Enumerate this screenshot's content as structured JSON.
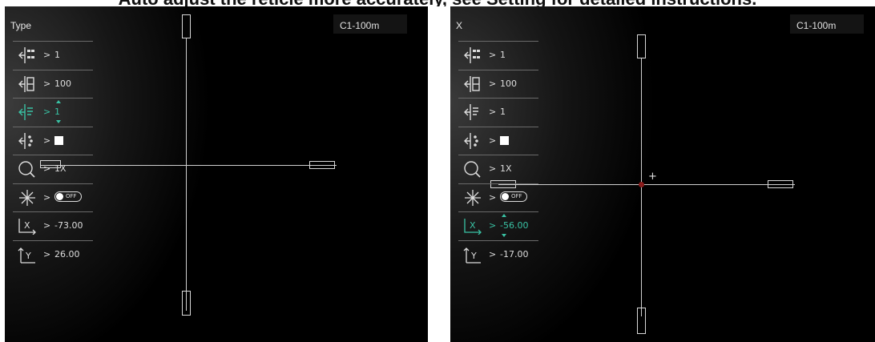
{
  "caption": "Auto adjust the reticle more accurately, see Setting for detailed instructions.",
  "panels": [
    {
      "title": "Type",
      "profile": "C1-100m",
      "items": [
        {
          "icon": "reticle-type-icon",
          "value": "1"
        },
        {
          "icon": "reticle-color-icon",
          "value": "100"
        },
        {
          "icon": "reticle-brightness-icon",
          "value": "1",
          "active": true
        },
        {
          "icon": "reticle-style-icon",
          "value": "solid-square"
        },
        {
          "icon": "zoom-icon",
          "value": "1X"
        },
        {
          "icon": "freeze-icon",
          "value": "OFF"
        },
        {
          "icon": "x-axis-icon",
          "value": "-73.00"
        },
        {
          "icon": "y-axis-icon",
          "value": "26.00"
        }
      ]
    },
    {
      "title": "X",
      "profile": "C1-100m",
      "items": [
        {
          "icon": "reticle-type-icon",
          "value": "1"
        },
        {
          "icon": "reticle-color-icon",
          "value": "100"
        },
        {
          "icon": "reticle-brightness-icon",
          "value": "1"
        },
        {
          "icon": "reticle-style-icon",
          "value": "solid-square"
        },
        {
          "icon": "zoom-icon",
          "value": "1X"
        },
        {
          "icon": "freeze-icon",
          "value": "OFF"
        },
        {
          "icon": "x-axis-icon",
          "value": "-56.00",
          "active": true
        },
        {
          "icon": "y-axis-icon",
          "value": "-17.00"
        }
      ]
    }
  ],
  "menu_arrow": ">",
  "colors": {
    "accent": "#39c2a4",
    "reticle": "#cfcfcf",
    "zero_point": "#8a1c1c"
  }
}
